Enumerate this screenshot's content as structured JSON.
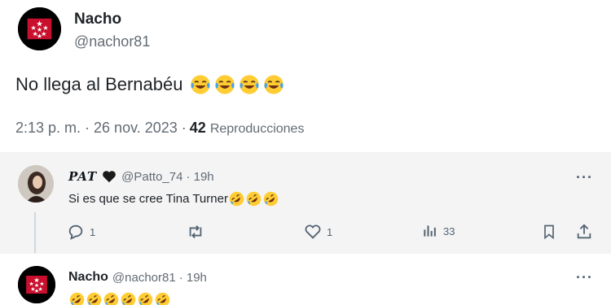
{
  "main_tweet": {
    "author_name": "Nacho",
    "author_handle": "@nachor81",
    "text": "No llega al Bernabéu",
    "emojis": [
      "face-with-tears-of-joy-emoji",
      "face-with-tears-of-joy-emoji",
      "face-with-tears-of-joy-emoji",
      "face-with-tears-of-joy-emoji"
    ],
    "timestamp": "2:13 p. m. · 26 nov. 2023 ·",
    "views_count": "42",
    "views_label": "Reproducciones"
  },
  "replies": [
    {
      "author_name": "PAT",
      "author_handle": "@Patto_74",
      "time": "· 19h",
      "text": "Si es que se cree Tina Turner",
      "emojis": [
        "rolling-on-floor-laughing-emoji",
        "rolling-on-floor-laughing-emoji",
        "rolling-on-floor-laughing-emoji"
      ],
      "more_label": "···",
      "actions": {
        "reply_count": "1",
        "retweet_count": "",
        "like_count": "1",
        "views_count": "33"
      }
    },
    {
      "author_name": "Nacho",
      "author_handle": "@nachor81",
      "time": "· 19h",
      "emojis": [
        "rolling-on-floor-laughing-emoji",
        "rolling-on-floor-laughing-emoji",
        "rolling-on-floor-laughing-emoji",
        "rolling-on-floor-laughing-emoji",
        "rolling-on-floor-laughing-emoji",
        "rolling-on-floor-laughing-emoji"
      ],
      "more_label": "···"
    }
  ],
  "icons": {
    "heart": "black-heart-icon",
    "reply": "comment-icon",
    "retweet": "retweet-icon",
    "like": "heart-outline-icon",
    "views": "bar-chart-icon",
    "bookmark": "bookmark-icon",
    "share": "share-icon"
  },
  "colors": {
    "avatar_flag_red": "#c8102e",
    "secondary_text": "#626b73",
    "reply_background": "#f4f4f5",
    "emoji_yellow": "#ffcc33"
  }
}
